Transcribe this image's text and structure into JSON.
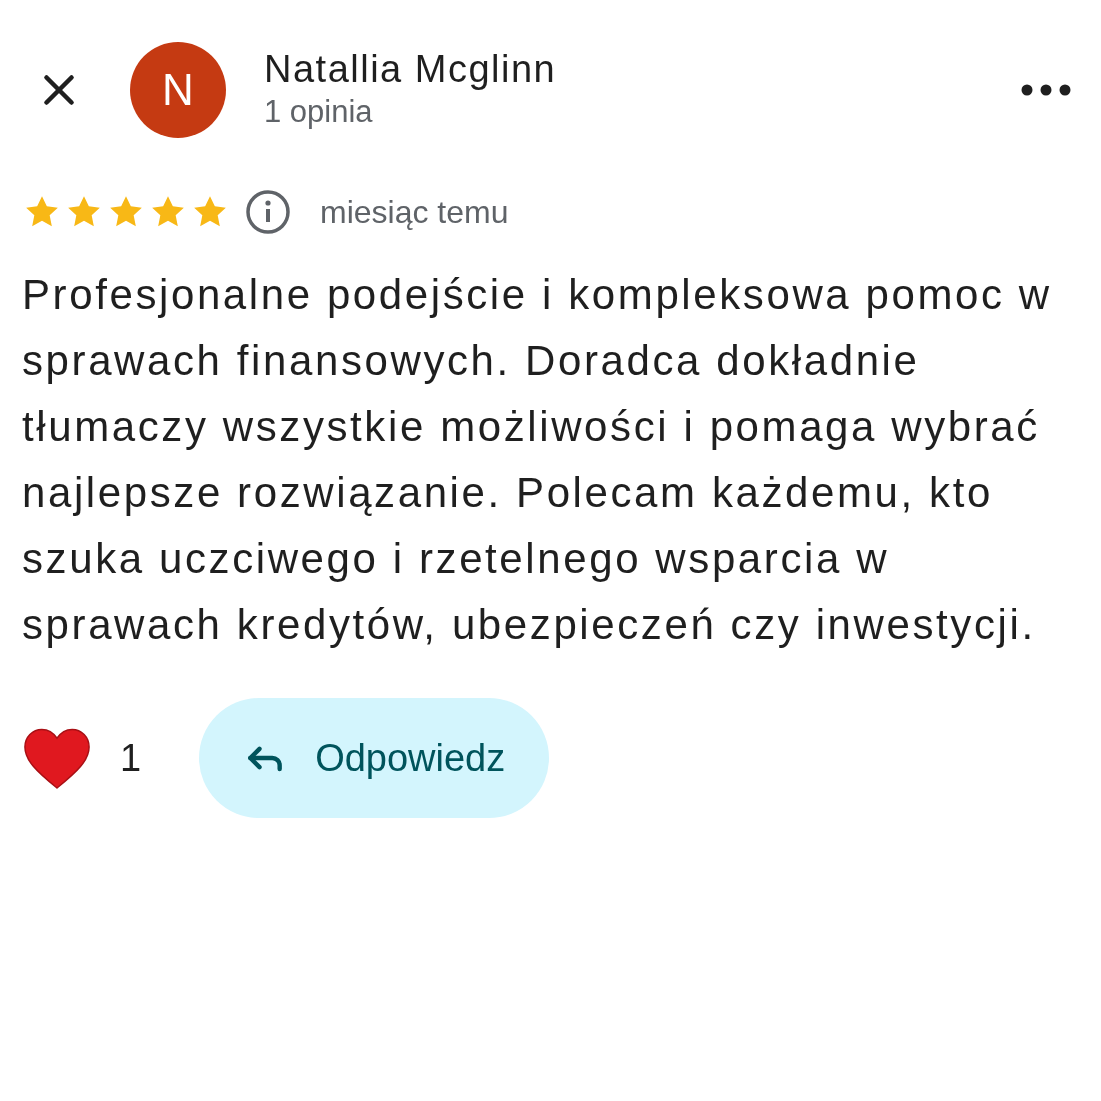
{
  "header": {
    "avatar_letter": "N",
    "name": "Natallia Mcglinn",
    "subtitle": "1 opinia"
  },
  "rating": {
    "stars": 5,
    "time": "miesiąc temu"
  },
  "review": {
    "text": "Profesjonalne podejście i kompleksowa pomoc w sprawach finansowych. Doradca dokładnie tłumaczy wszystkie możliwości i pomaga wybrać najlepsze rozwiązanie. Polecam każdemu, kto szuka uczciwego i rzetelnego wsparcia w sprawach kredytów, ubezpieczeń czy inwestycji."
  },
  "reactions": {
    "count": "1",
    "reply_label": "Odpowiedz"
  }
}
